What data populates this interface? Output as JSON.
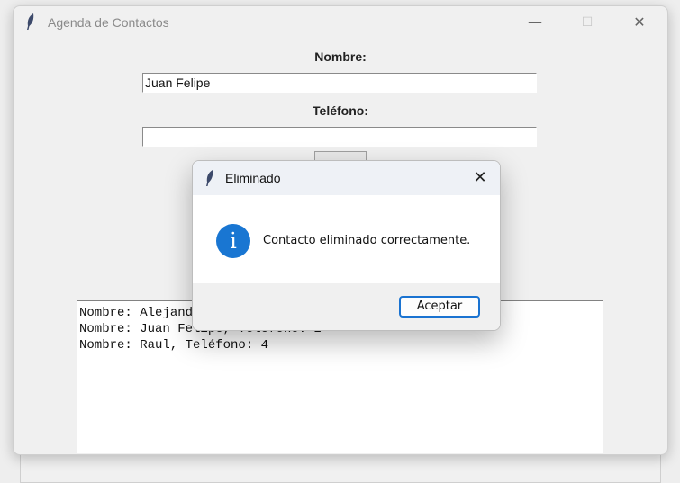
{
  "main_window": {
    "title": "Agenda de Contactos",
    "minimize_glyph": "—",
    "maximize_glyph": "☐",
    "close_glyph": "✕"
  },
  "form": {
    "name_label": "Nombre:",
    "name_value": "Juan Felipe",
    "phone_label": "Teléfono:",
    "phone_value": ""
  },
  "contacts_list": [
    "Nombre: Alejandro, Teléfono: 1",
    "Nombre: Juan Felipe, Teléfono: 2",
    "Nombre: Raul, Teléfono: 4"
  ],
  "dialog": {
    "title": "Eliminado",
    "message": "Contacto eliminado correctamente.",
    "icon": "info-icon",
    "icon_glyph": "i",
    "ok_label": "Aceptar",
    "close_glyph": "✕"
  },
  "colors": {
    "accent": "#1a73d1",
    "info_icon": "#1976d2",
    "feather": "#3d4a6b"
  }
}
